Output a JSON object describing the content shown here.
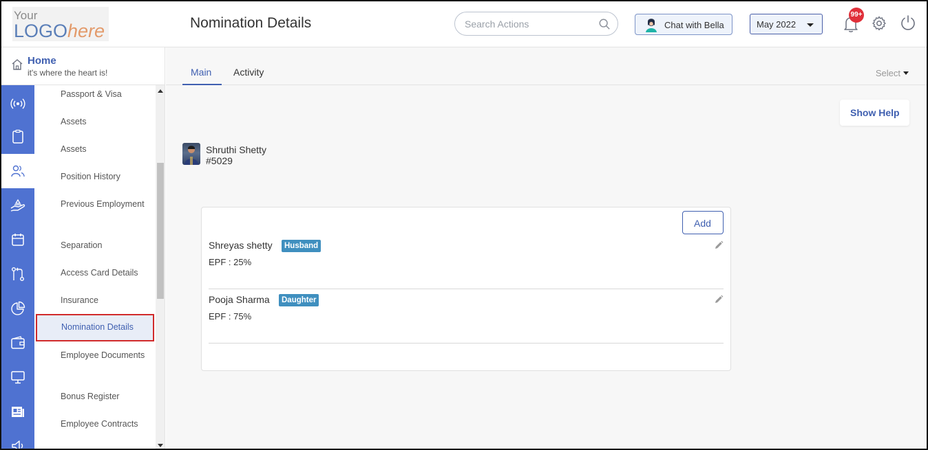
{
  "brand": {
    "logo_top": "Your",
    "logo_main": "LOGO",
    "logo_suffix": "here"
  },
  "header": {
    "title": "Nomination Details",
    "search_placeholder": "Search Actions",
    "chat_label": "Chat with Bella",
    "month": "May 2022",
    "notification_count": "99+"
  },
  "home": {
    "title": "Home",
    "subtitle": "it's where the heart is!"
  },
  "rail": {
    "icons": [
      "broadcast-icon",
      "clipboard-icon",
      "people-icon",
      "hand-holding-icon",
      "calendar-icon",
      "workflow-icon",
      "pie-chart-icon",
      "wallet-icon",
      "monitor-icon",
      "news-icon",
      "megaphone-icon"
    ],
    "active_index": 2
  },
  "submenu": {
    "items": [
      "Passport & Visa",
      "Assets",
      "Assets",
      "Position History",
      "Previous Employment",
      "Separation",
      "Access Card Details",
      "Insurance",
      "Nomination Details",
      "Employee Documents",
      "Bonus Register",
      "Employee Contracts"
    ],
    "active": "Nomination Details"
  },
  "tabs": {
    "main": "Main",
    "activity": "Activity",
    "select": "Select"
  },
  "help_button": "Show Help",
  "employee": {
    "name": "Shruthi Shetty",
    "id": "#5029"
  },
  "nominations": {
    "add_label": "Add",
    "items": [
      {
        "name": "Shreyas shetty",
        "relation": "Husband",
        "epf": "EPF : 25%"
      },
      {
        "name": "Pooja Sharma",
        "relation": "Daughter",
        "epf": "EPF : 75%"
      }
    ]
  },
  "colors": {
    "primary": "#3f5fb0",
    "rail": "#4f72d1",
    "badge": "#e0303a",
    "relation_tag": "#3f8fbf"
  }
}
